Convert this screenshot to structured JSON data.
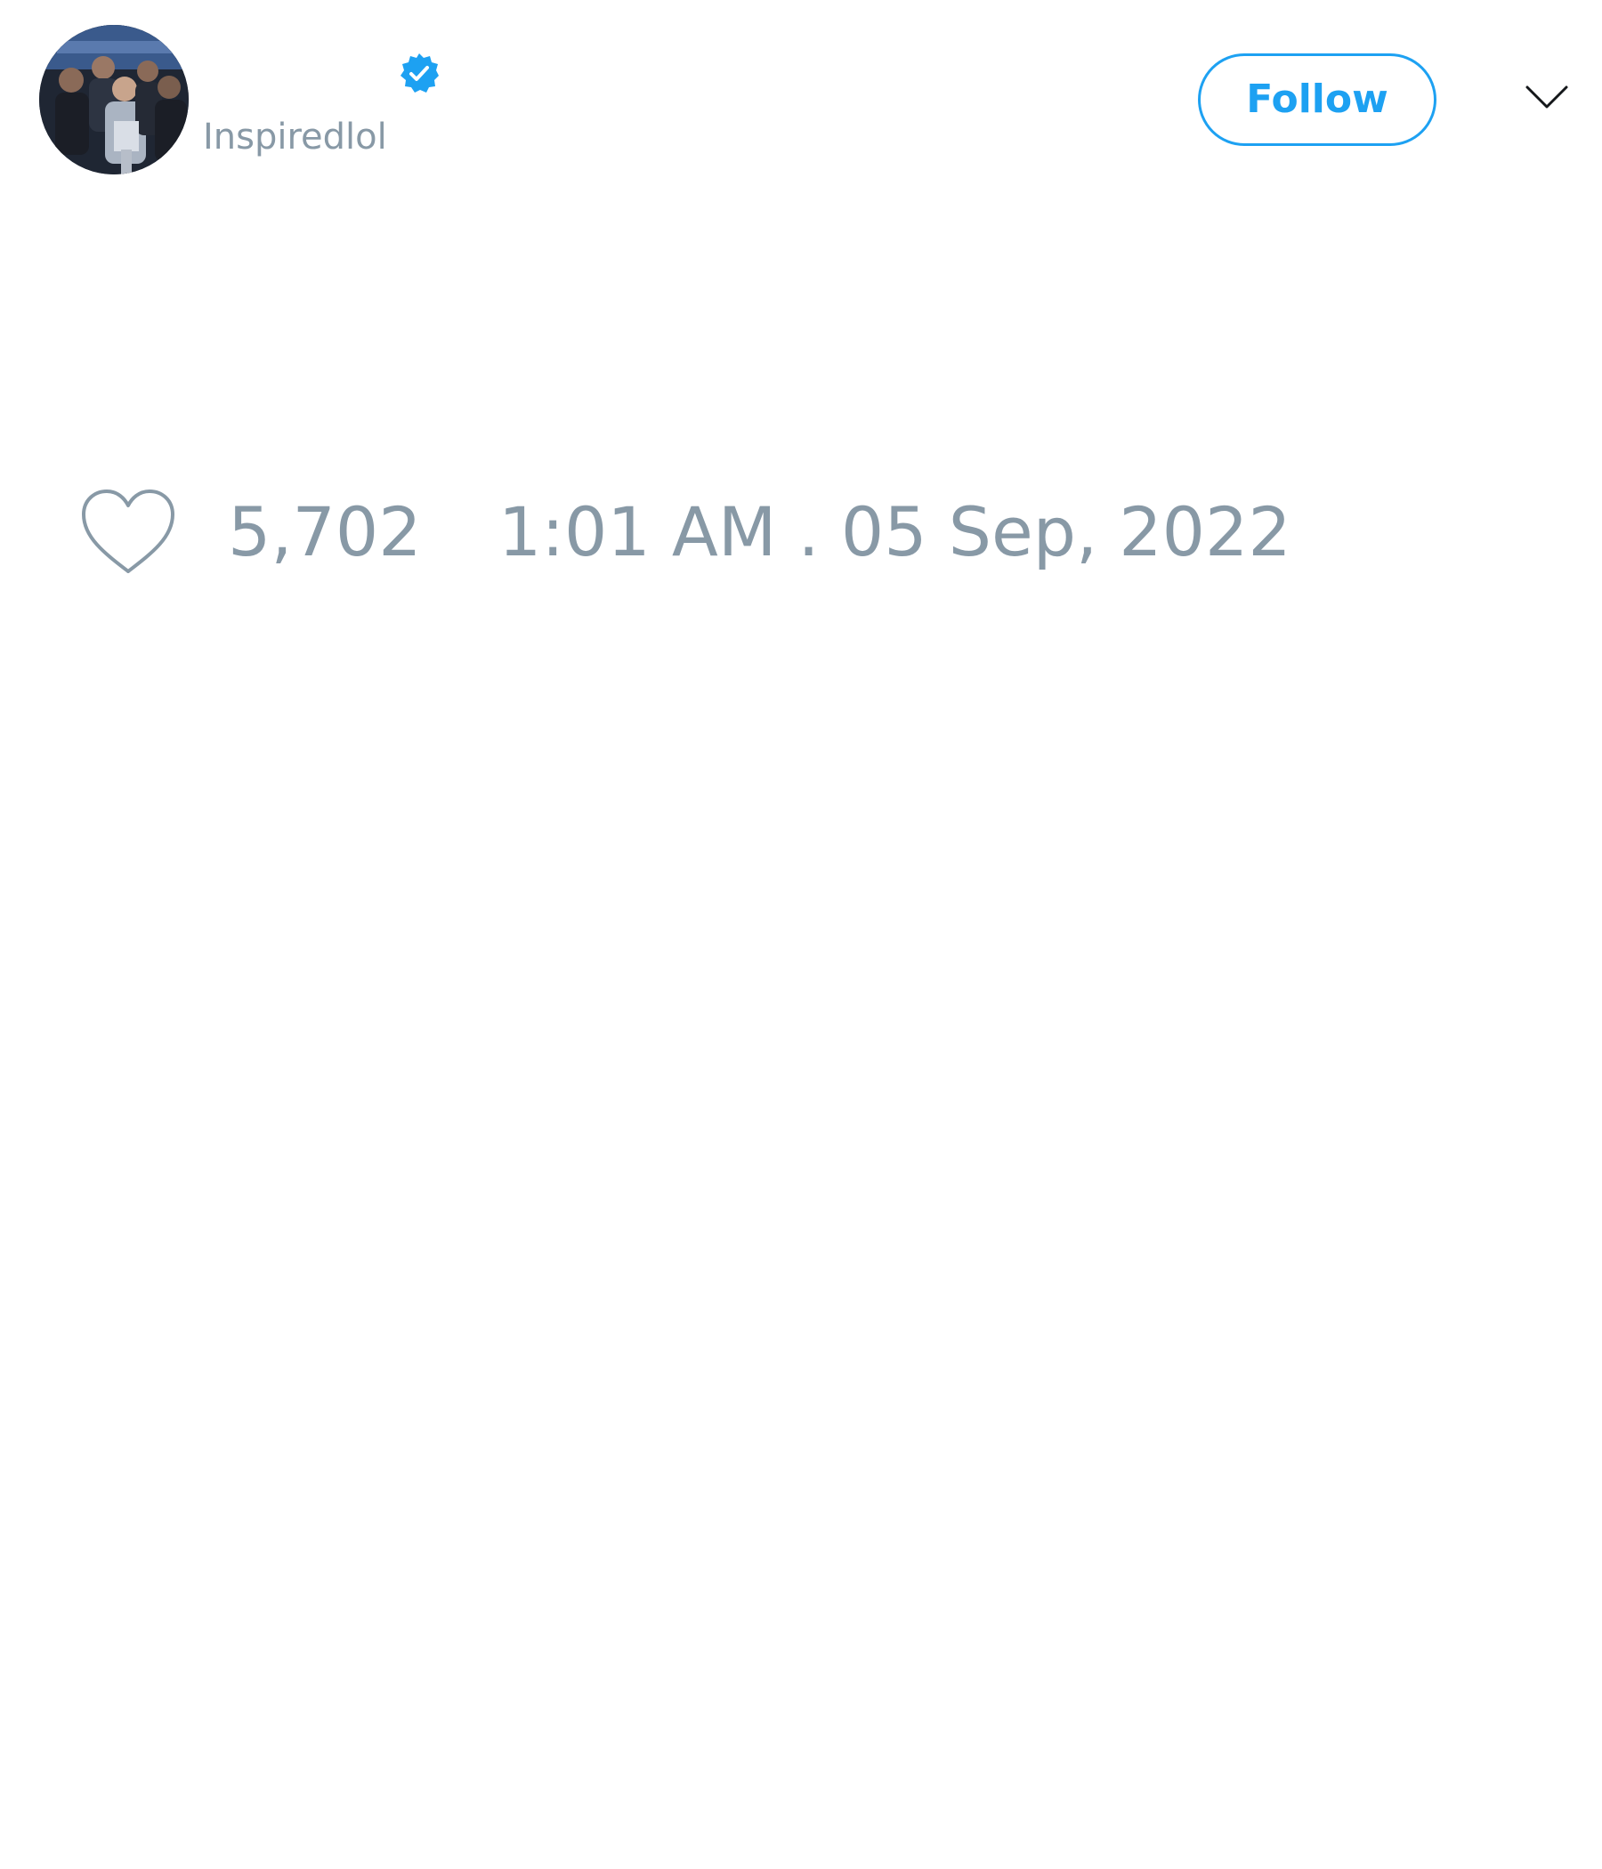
{
  "header": {
    "avatar_icon": "team-photo-avatar",
    "verified_icon": "verified-badge-icon",
    "handle": "Inspiredlol",
    "follow_label": "Follow",
    "menu_icon": "chevron-down-icon"
  },
  "footer": {
    "like_icon": "heart-icon",
    "like_count": "5,702",
    "timestamp": "1:01 AM . 05 Sep, 2022"
  },
  "colors": {
    "accent": "#1da1f2",
    "muted_text": "#8899a6",
    "background": "#ffffff"
  }
}
